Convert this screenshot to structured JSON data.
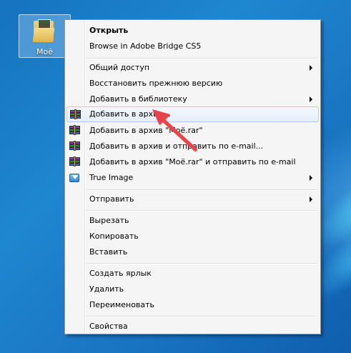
{
  "desktop": {
    "folder_label": "Моё"
  },
  "context_menu": {
    "open": "Открыть",
    "browse_bridge": "Browse in Adobe Bridge CS5",
    "share": "Общий доступ",
    "restore_prev": "Восстановить прежнюю версию",
    "add_library": "Добавить в библиотеку",
    "add_archive": "Добавить в архив...",
    "add_rar": "Добавить в архив \"Моё.rar\"",
    "add_email": "Добавить в архив и отправить по e-mail...",
    "add_rar_email": "Добавить в архив \"Моё.rar\" и отправить по e-mail",
    "true_image": "True Image",
    "send_to": "Отправить",
    "cut": "Вырезать",
    "copy": "Копировать",
    "paste": "Вставить",
    "create_shortcut": "Создать ярлык",
    "delete": "Удалить",
    "rename": "Переименовать",
    "properties": "Свойства"
  },
  "icons": {
    "rar": "winrar-archive-icon",
    "true_image": "true-image-icon",
    "submenu": "chevron-right-icon"
  },
  "colors": {
    "hover_border": "#aecff7",
    "annotation_arrow": "#e8434b",
    "desktop_blue": "#1a78c6"
  }
}
